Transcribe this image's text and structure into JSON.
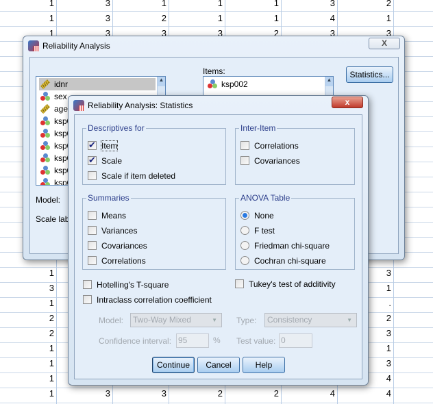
{
  "grid": {
    "top_rows": [
      [
        "1",
        "3",
        "1",
        "1",
        "1",
        "3",
        "2"
      ],
      [
        "1",
        "3",
        "2",
        "1",
        "1",
        "4",
        "1"
      ],
      [
        "1",
        "3",
        "3",
        "3",
        "2",
        "3",
        "3"
      ]
    ],
    "bottom_left_col": [
      "1",
      "3",
      "1",
      "2",
      "2",
      "1",
      "1",
      "1"
    ],
    "bottom_right_col": [
      "3",
      "1",
      ".",
      "2",
      "3",
      "1",
      "3",
      "4"
    ],
    "last_row": [
      "1",
      "3",
      "3",
      "2",
      "2",
      "4",
      "4"
    ]
  },
  "main_dialog": {
    "title": "Reliability Analysis",
    "close": "X",
    "variables": [
      {
        "name": "idnr",
        "type": "scale",
        "selected": true
      },
      {
        "name": "sex",
        "type": "nominal"
      },
      {
        "name": "age",
        "type": "scale"
      },
      {
        "name": "ksp0",
        "type": "nominal"
      },
      {
        "name": "ksp0",
        "type": "nominal"
      },
      {
        "name": "ksp0",
        "type": "nominal"
      },
      {
        "name": "ksp0",
        "type": "nominal"
      },
      {
        "name": "ksp0",
        "type": "nominal"
      },
      {
        "name": "ksp0",
        "type": "nominal"
      }
    ],
    "items_label": "Items:",
    "items": [
      {
        "name": "ksp002",
        "type": "nominal"
      }
    ],
    "statistics_button": "Statistics...",
    "model_label": "Model:",
    "scale_label": "Scale lab"
  },
  "stats_dialog": {
    "title": "Reliability Analysis: Statistics",
    "close": "x",
    "descriptives": {
      "title": "Descriptives for",
      "items": [
        {
          "label": "Item",
          "checked": true
        },
        {
          "label": "Scale",
          "checked": true
        },
        {
          "label": "Scale if item deleted",
          "checked": false
        }
      ]
    },
    "inter_item": {
      "title": "Inter-Item",
      "items": [
        {
          "label": "Correlations",
          "checked": false
        },
        {
          "label": "Covariances",
          "checked": false
        }
      ]
    },
    "summaries": {
      "title": "Summaries",
      "items": [
        {
          "label": "Means",
          "checked": false
        },
        {
          "label": "Variances",
          "checked": false
        },
        {
          "label": "Covariances",
          "checked": false
        },
        {
          "label": "Correlations",
          "checked": false
        }
      ]
    },
    "anova": {
      "title": "ANOVA Table",
      "selected": "None",
      "options": [
        "None",
        "F test",
        "Friedman chi-square",
        "Cochran chi-square"
      ]
    },
    "hotelling": {
      "label": "Hotelling's T-square",
      "checked": false
    },
    "tukey": {
      "label": "Tukey's test of additivity",
      "checked": false
    },
    "intraclass": {
      "label": "Intraclass correlation coefficient",
      "checked": false
    },
    "model_label": "Model:",
    "model_value": "Two-Way Mixed",
    "type_label": "Type:",
    "type_value": "Consistency",
    "ci_label": "Confidence interval:",
    "ci_value": "95",
    "ci_unit": "%",
    "test_value_label": "Test value:",
    "test_value": "0",
    "buttons": {
      "continue": "Continue",
      "cancel": "Cancel",
      "help": "Help"
    }
  }
}
